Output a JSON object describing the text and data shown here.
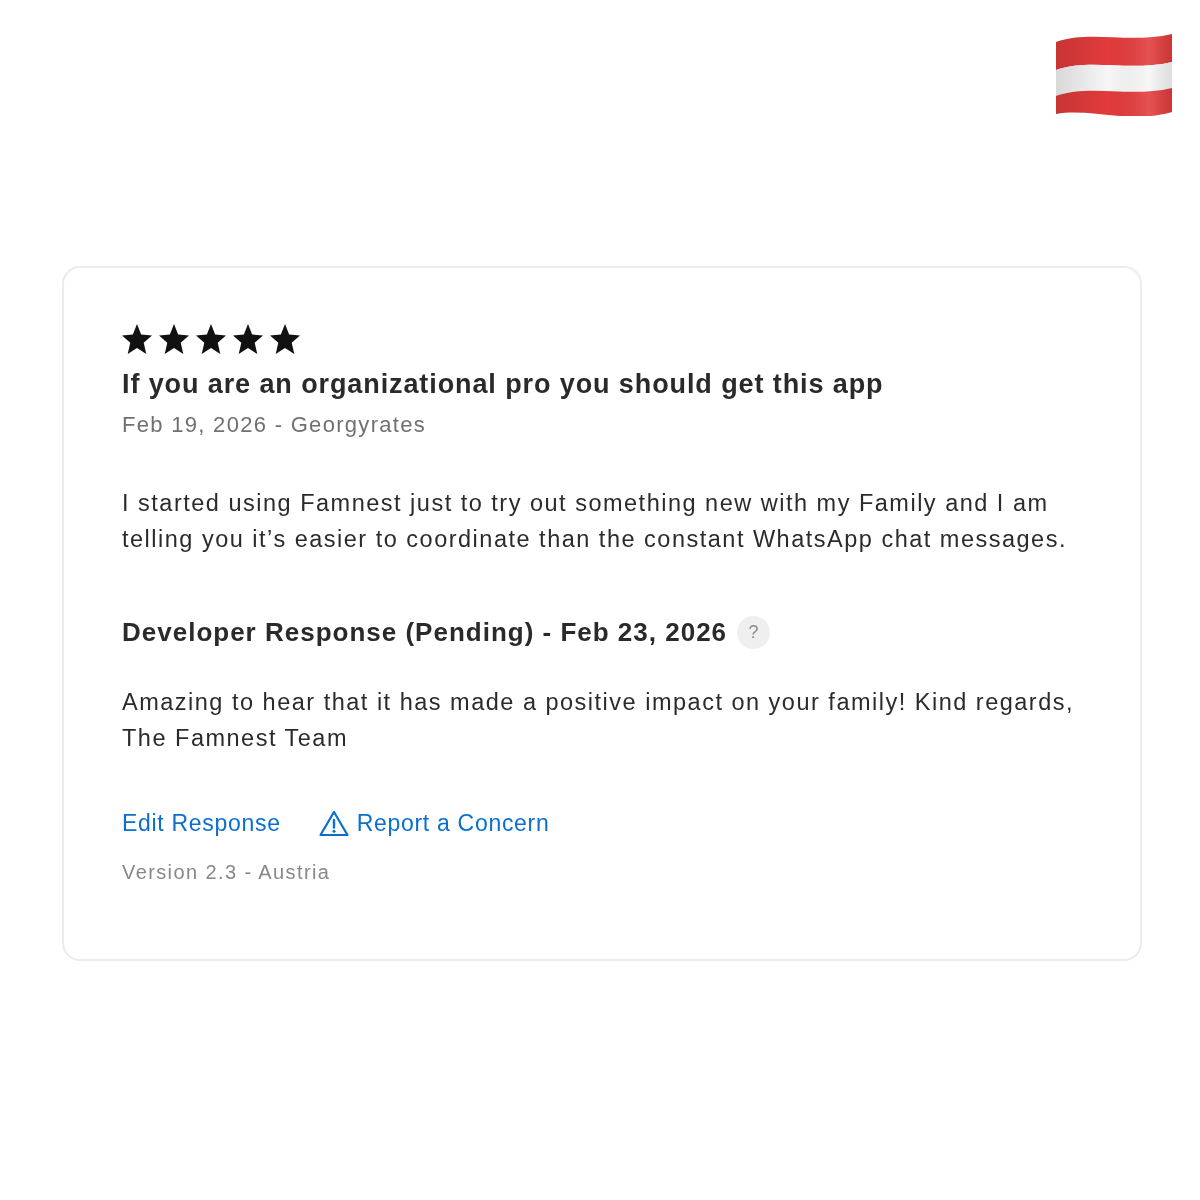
{
  "review": {
    "stars": 5,
    "title": "If you are an organizational pro you should get this app",
    "meta": "Feb 19, 2026 - Georgyrates",
    "body": "I started using Famnest just to try out something new with my Family and I am telling you it’s easier to coordinate than the constant WhatsApp chat messages."
  },
  "developer_response": {
    "heading": "Developer Response (Pending) - Feb 23, 2026",
    "help": "?",
    "body": "Amazing to hear that it has made a positive impact on your family! Kind regards, The Famnest Team"
  },
  "actions": [
    {
      "kind": "plain",
      "label": "Edit Response"
    },
    {
      "kind": "warning",
      "label": "Report a Concern"
    }
  ],
  "footer": "Version 2.3 - Austria"
}
